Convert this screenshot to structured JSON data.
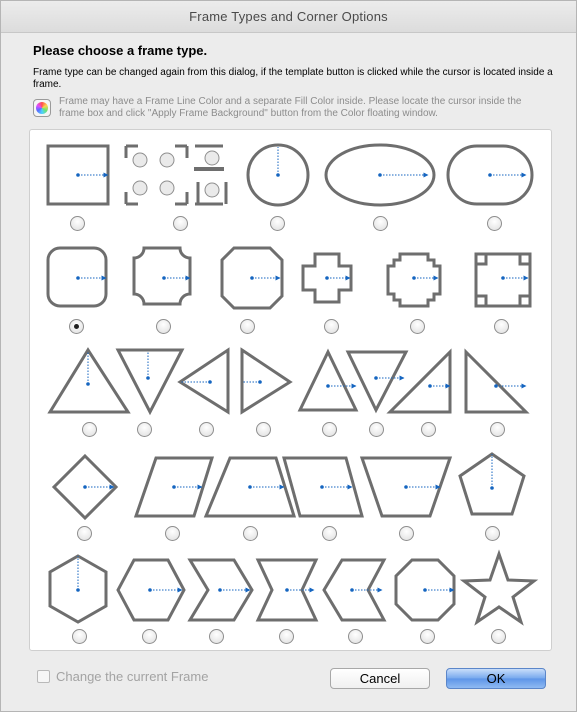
{
  "window": {
    "title": "Frame Types and Corner Options"
  },
  "dialog": {
    "heading": "Please choose a frame type.",
    "description": "Frame type can be changed again from this dialog, if the template button is clicked while the cursor is located inside a frame.",
    "hint": "Frame may have a Frame Line Color and a separate Fill Color inside. Please locate the cursor inside the frame box and click \"Apply Frame Background\" button from the Color floating window.",
    "hint_icon": "color-wheel-icon"
  },
  "frame_options": {
    "selected_index": 6,
    "rows": [
      [
        "rectangle",
        "corner-marks",
        "circle",
        "ellipse",
        "pill"
      ],
      [
        "rounded-rectangle",
        "inverted-round-corners",
        "chamfered-octagon",
        "plus-notched",
        "stepped-corners",
        "bracket-corners"
      ],
      [
        "triangle-up",
        "triangle-down",
        "triangle-left",
        "triangle-right",
        "triangle-up-small",
        "triangle-down-small",
        "right-triangle-left",
        "right-triangle-right"
      ],
      [
        "diamond",
        "parallelogram-right",
        "trapezoid-up",
        "parallelogram-left",
        "trapezoid-down",
        "pentagon"
      ],
      [
        "hexagon-vertical",
        "hexagon-horizontal",
        "chevron-right",
        "hourglass-notch",
        "chevron-left",
        "octagon",
        "star"
      ]
    ]
  },
  "footer": {
    "change_current_label": "Change the current Frame",
    "change_current_checked": false,
    "cancel_label": "Cancel",
    "ok_label": "OK"
  },
  "colors": {
    "shape_stroke": "#6e6e6e",
    "pointer": "#1565c0",
    "ok_button": "#6ea0ec"
  }
}
